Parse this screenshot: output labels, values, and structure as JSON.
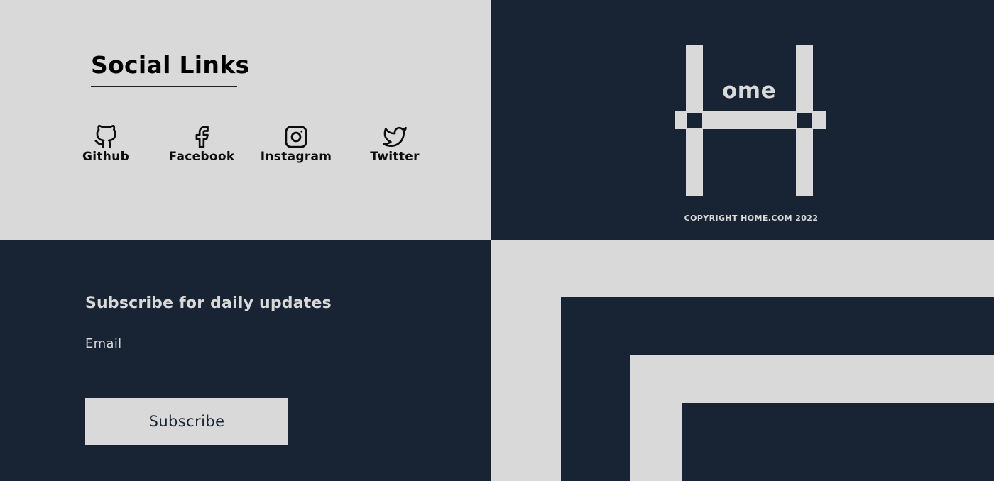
{
  "social": {
    "title": "Social Links",
    "links": [
      {
        "label": "Github",
        "icon": "github-icon"
      },
      {
        "label": "Facebook",
        "icon": "facebook-icon"
      },
      {
        "label": "Instagram",
        "icon": "instagram-icon"
      },
      {
        "label": "Twitter",
        "icon": "twitter-icon"
      }
    ]
  },
  "logo": {
    "letter_text": "ome",
    "copyright": "COPYRIGHT HOME.COM 2022"
  },
  "subscribe": {
    "title": "Subscribe for daily updates",
    "email_label": "Email",
    "email_value": "",
    "email_placeholder": "",
    "button_label": "Subscribe"
  },
  "colors": {
    "light": "#d9d9d9",
    "dark": "#182433"
  }
}
